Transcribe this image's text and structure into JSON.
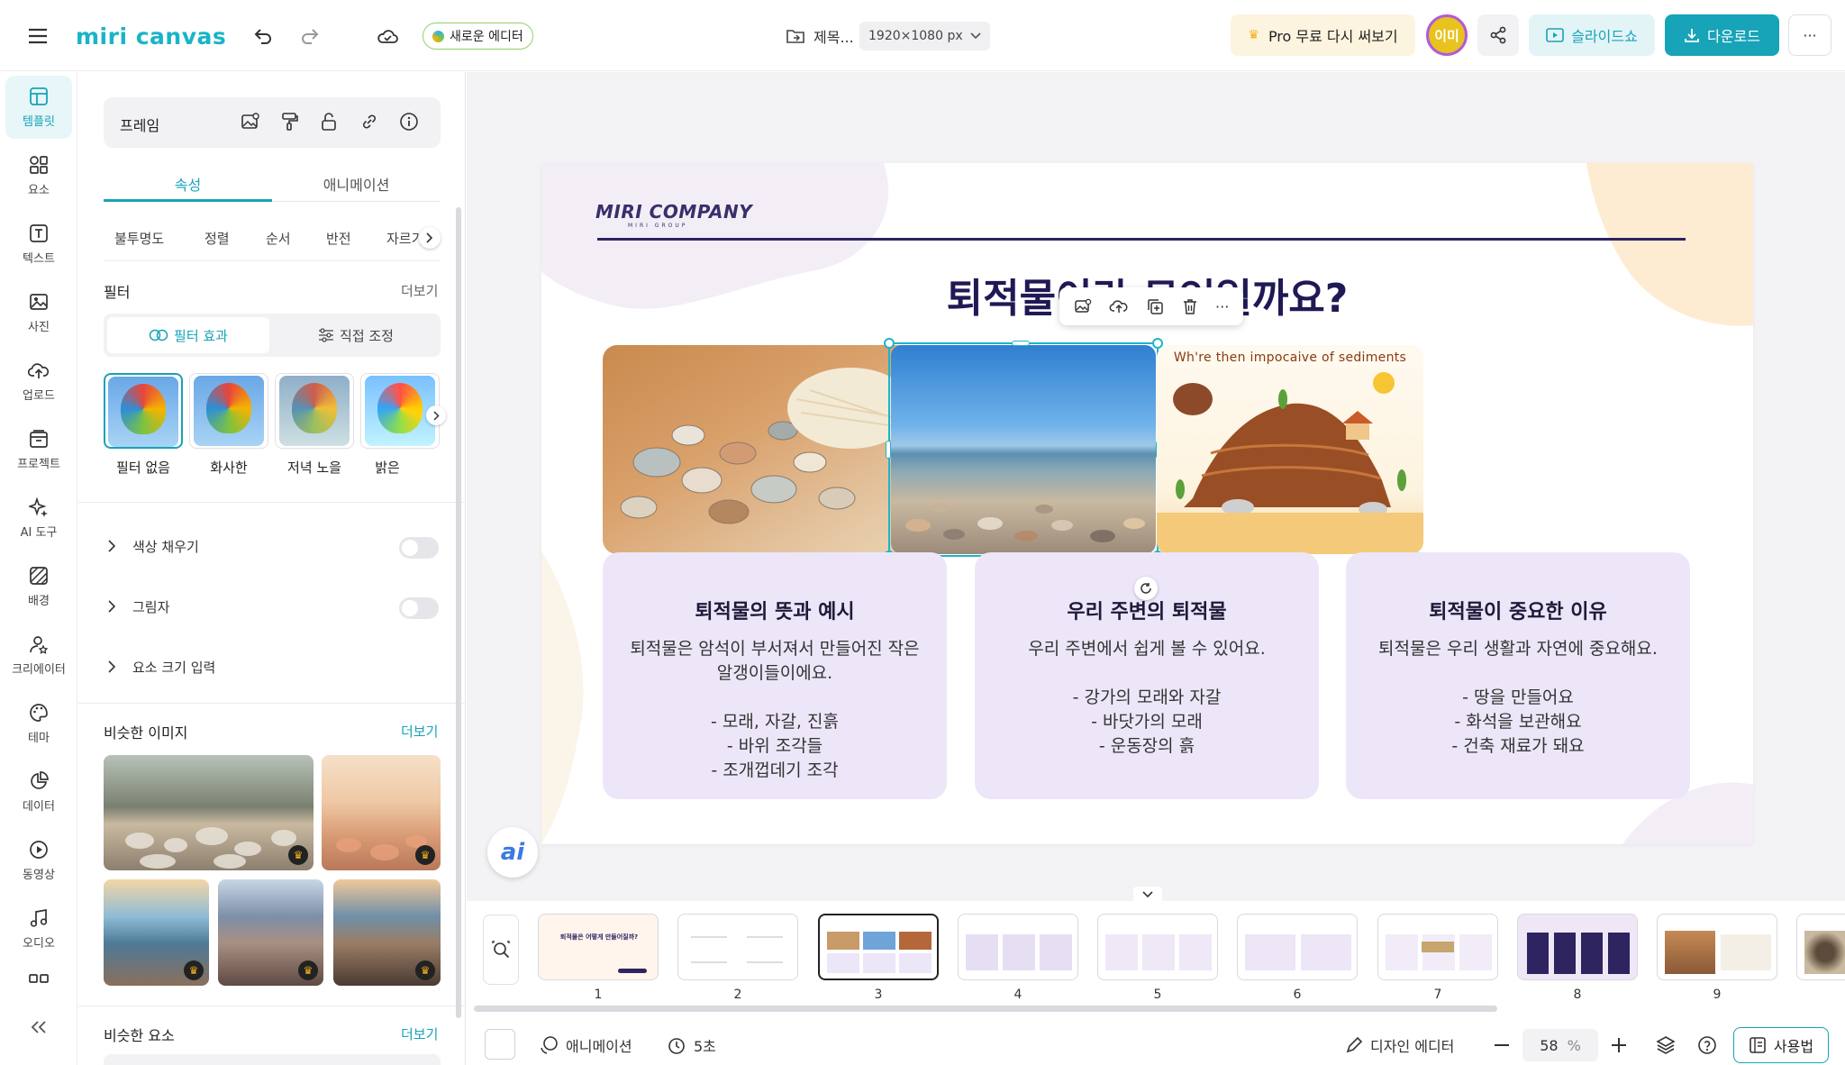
{
  "topbar": {
    "logo": "miri canvas",
    "new_editor": "새로운 에디터",
    "doc_title": "제목...",
    "doc_size": "1920×1080 px",
    "pro_label": "Pro 무료 다시 써보기",
    "avatar": "이미",
    "slideshow": "슬라이드쇼",
    "download": "다운로드",
    "more": "···",
    "accent": "#1eb4c8"
  },
  "nav": [
    {
      "label": "템플릿",
      "icon": "template-icon"
    },
    {
      "label": "요소",
      "icon": "elements-icon"
    },
    {
      "label": "텍스트",
      "icon": "text-icon"
    },
    {
      "label": "사진",
      "icon": "photo-icon"
    },
    {
      "label": "업로드",
      "icon": "upload-icon"
    },
    {
      "label": "프로젝트",
      "icon": "project-icon"
    },
    {
      "label": "AI 도구",
      "icon": "ai-icon"
    },
    {
      "label": "배경",
      "icon": "background-icon"
    },
    {
      "label": "크리에이터",
      "icon": "creator-icon"
    },
    {
      "label": "테마",
      "icon": "palette-icon"
    },
    {
      "label": "데이터",
      "icon": "chart-icon"
    },
    {
      "label": "동영상",
      "icon": "video-icon"
    },
    {
      "label": "오디오",
      "icon": "audio-icon"
    }
  ],
  "panel": {
    "header": "프레임",
    "tabs": [
      "속성",
      "애니메이션"
    ],
    "subtabs": [
      "불투명도",
      "정렬",
      "순서",
      "반전",
      "자르기"
    ],
    "filter": {
      "title": "필터",
      "more": "더보기",
      "effect": "필터 효과",
      "adjust": "직접 조정",
      "items": [
        "필터 없음",
        "화사한",
        "저녁 노을",
        "밝은"
      ]
    },
    "options": [
      "색상 채우기",
      "그림자",
      "요소 크기 입력"
    ],
    "similar_images": {
      "title": "비슷한 이미지",
      "more": "더보기"
    },
    "similar_elements": {
      "title": "비슷한 요소",
      "more": "더보기"
    }
  },
  "slide": {
    "company": "MIRI COMPANY",
    "company_sub": "MIRI GROUP",
    "title": "퇴적물이란 무엇일까요?",
    "diagram_title": "Wh're then impocaive of sediments",
    "cards": [
      {
        "heading": "퇴적물의 뜻과 예시",
        "body": "퇴적물은 암석이 부서져서 만들어진 작은 알갱이들이에요.\n\n- 모래, 자갈, 진흙\n- 바위 조각들\n- 조개껍데기 조각"
      },
      {
        "heading": "우리 주변의 퇴적물",
        "body": "우리 주변에서 쉽게 볼 수 있어요.\n\n- 강가의 모래와 자갈\n- 바닷가의 모래\n- 운동장의 흙"
      },
      {
        "heading": "퇴적물이 중요한 이유",
        "body": "퇴적물은 우리 생활과 자연에 중요해요.\n\n- 땅을 만들어요\n- 화석을 보관해요\n- 건축 재료가 돼요"
      }
    ]
  },
  "ai_button": "ai",
  "thumbnails": [
    "1",
    "2",
    "3",
    "4",
    "5",
    "6",
    "7",
    "8",
    "9"
  ],
  "thumb1_title": "퇴적물은 어떻게 만들어질까?",
  "bottom": {
    "animation": "애니메이션",
    "duration": "5초",
    "design_editor": "디자인 에디터",
    "zoom": "58",
    "zoom_unit": "%",
    "howto": "사용법"
  }
}
